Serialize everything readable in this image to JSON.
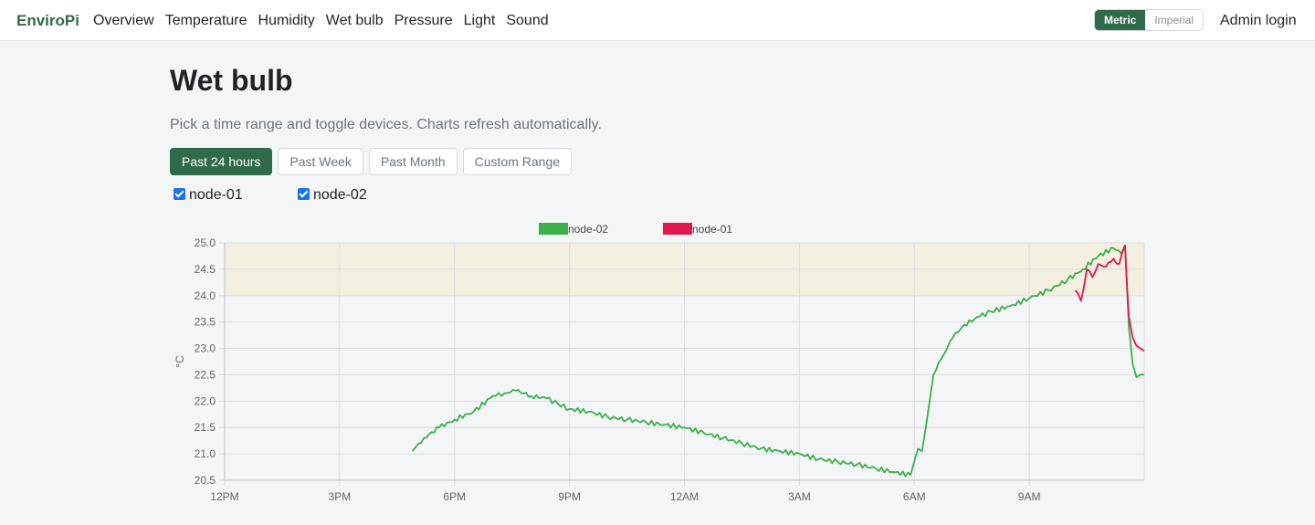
{
  "navbar": {
    "brand": "EnviroPi",
    "links": [
      "Overview",
      "Temperature",
      "Humidity",
      "Wet bulb",
      "Pressure",
      "Light",
      "Sound"
    ],
    "units": {
      "metric": "Metric",
      "imperial": "Imperial",
      "active": "metric"
    },
    "admin_login": "Admin login"
  },
  "page": {
    "title": "Wet bulb",
    "subtitle": "Pick a time range and toggle devices. Charts refresh automatically."
  },
  "range_buttons": [
    "Past 24 hours",
    "Past Week",
    "Past Month",
    "Custom Range"
  ],
  "active_range": "Past 24 hours",
  "devices": [
    {
      "name": "node-01",
      "checked": true
    },
    {
      "name": "node-02",
      "checked": true
    }
  ],
  "colors": {
    "accent": "#2f6b4a",
    "node-02": "#3bb04b",
    "node-01": "#e0174f",
    "band": "#f3f0e2"
  },
  "chart_data": {
    "type": "line",
    "ylabel": "°C",
    "ylim": [
      20.5,
      25.0
    ],
    "yticks": [
      "25.0",
      "24.5",
      "24.0",
      "23.5",
      "23.0",
      "22.5",
      "22.0",
      "21.5",
      "21.0",
      "20.5"
    ],
    "xlim": [
      0,
      24
    ],
    "xticks": [
      {
        "v": 0,
        "label": "12PM"
      },
      {
        "v": 3,
        "label": "3PM"
      },
      {
        "v": 6,
        "label": "6PM"
      },
      {
        "v": 9,
        "label": "9PM"
      },
      {
        "v": 12,
        "label": "12AM"
      },
      {
        "v": 15,
        "label": "3AM"
      },
      {
        "v": 18,
        "label": "6AM"
      },
      {
        "v": 21,
        "label": "9AM"
      }
    ],
    "grid": true,
    "legend": "top-center",
    "band": {
      "from": 24.0,
      "to": 25.0
    },
    "series": [
      {
        "name": "node-02",
        "color": "#3bb04b",
        "x": [
          4.9,
          5.2,
          5.6,
          6.0,
          6.5,
          7.0,
          7.3,
          7.6,
          8.0,
          8.4,
          8.7,
          9.0,
          9.5,
          10.0,
          10.5,
          11.0,
          11.5,
          12.0,
          12.5,
          13.0,
          13.5,
          14.0,
          14.5,
          15.0,
          15.5,
          16.0,
          16.5,
          17.0,
          17.5,
          17.9,
          18.1,
          18.2,
          18.3,
          18.4,
          18.5,
          18.7,
          19.0,
          19.3,
          19.7,
          20.0,
          20.5,
          21.0,
          21.5,
          22.0,
          22.4,
          22.8,
          23.2,
          23.4,
          23.5,
          23.6,
          23.7,
          23.8,
          23.9,
          24.0
        ],
        "y": [
          21.05,
          21.3,
          21.5,
          21.65,
          21.8,
          22.1,
          22.15,
          22.2,
          22.1,
          22.05,
          21.95,
          21.85,
          21.8,
          21.7,
          21.65,
          21.6,
          21.55,
          21.5,
          21.4,
          21.3,
          21.2,
          21.1,
          21.05,
          21.0,
          20.9,
          20.85,
          20.8,
          20.72,
          20.65,
          20.6,
          21.1,
          21.05,
          21.5,
          22.0,
          22.5,
          22.8,
          23.2,
          23.45,
          23.6,
          23.7,
          23.8,
          23.95,
          24.1,
          24.3,
          24.5,
          24.75,
          24.9,
          24.8,
          24.95,
          23.4,
          22.7,
          22.45,
          22.5,
          22.5
        ]
      },
      {
        "name": "node-01",
        "color": "#e0174f",
        "x": [
          22.2,
          22.35,
          22.5,
          22.65,
          22.8,
          23.0,
          23.2,
          23.35,
          23.5,
          23.55,
          23.6,
          23.7,
          23.8,
          23.9,
          24.0
        ],
        "y": [
          24.1,
          23.9,
          24.5,
          24.35,
          24.6,
          24.55,
          24.7,
          24.6,
          24.95,
          24.2,
          23.6,
          23.2,
          23.05,
          23.0,
          22.95
        ]
      }
    ]
  }
}
